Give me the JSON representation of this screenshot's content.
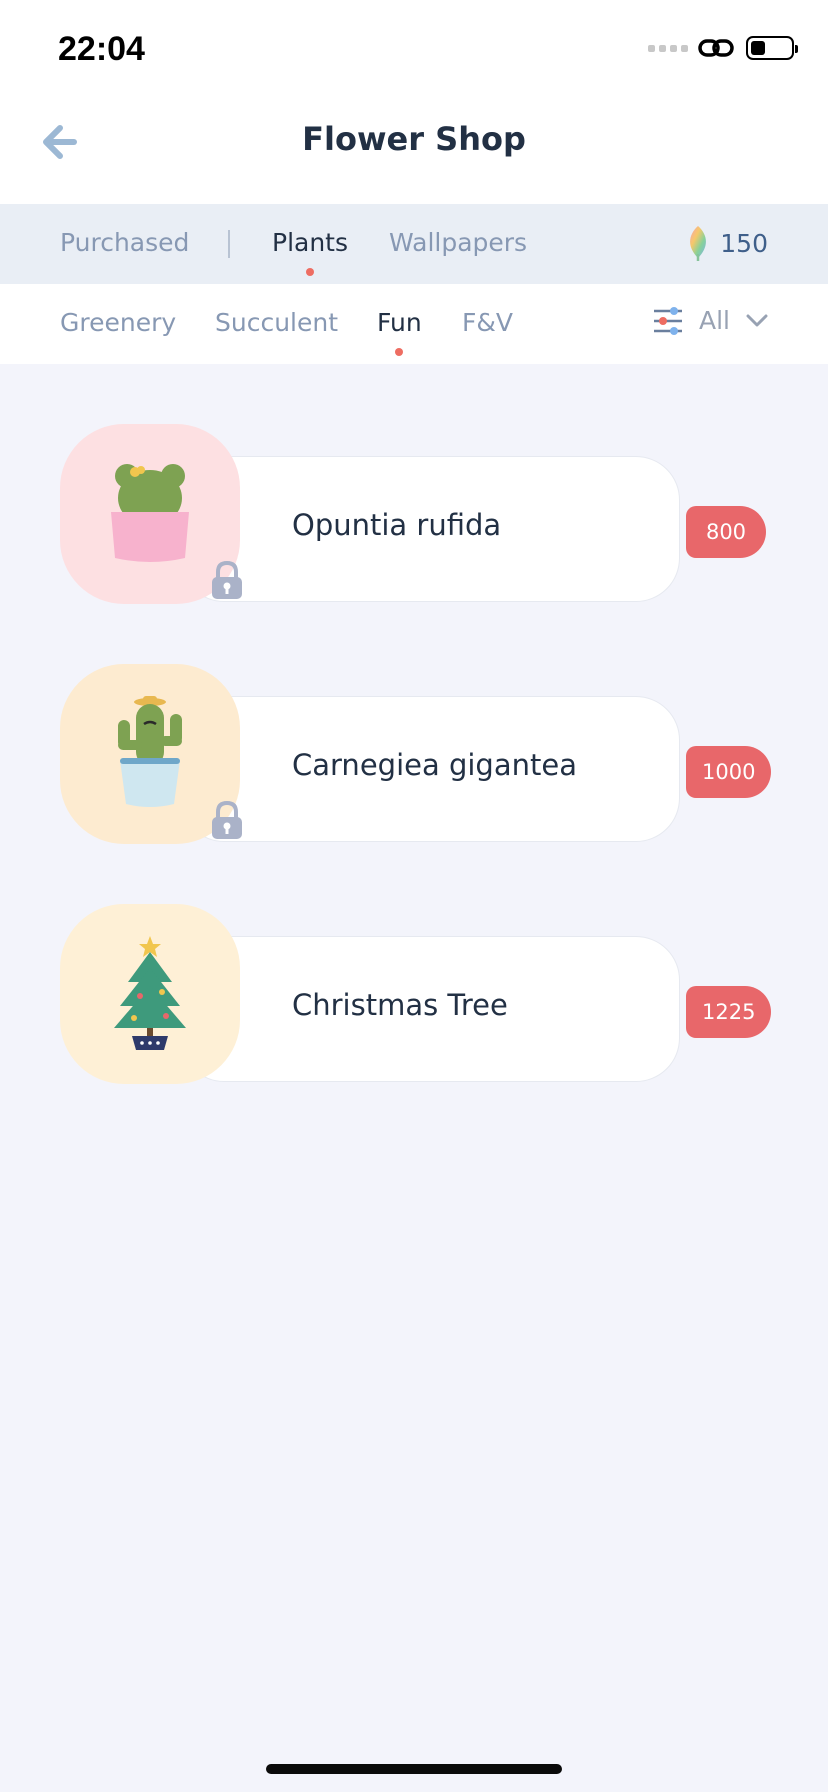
{
  "status_bar": {
    "time": "22:04"
  },
  "header": {
    "title": "Flower Shop"
  },
  "main_tabs": [
    {
      "label": "Purchased",
      "active": false
    },
    {
      "label": "Plants",
      "active": true
    },
    {
      "label": "Wallpapers",
      "active": false
    }
  ],
  "points": {
    "value": "150"
  },
  "sub_tabs": [
    {
      "label": "Greenery",
      "active": false
    },
    {
      "label": "Succulent",
      "active": false
    },
    {
      "label": "Fun",
      "active": true
    },
    {
      "label": "F&V",
      "active": false
    }
  ],
  "filter": {
    "label": "All"
  },
  "items": [
    {
      "name": "Opuntia rufida",
      "price": "800",
      "locked": true,
      "thumb_color": "#fde0e2",
      "icon": "opuntia-cactus-icon"
    },
    {
      "name": "Carnegiea gigantea",
      "price": "1000",
      "locked": true,
      "thumb_color": "#fdebd0",
      "icon": "saguaro-cactus-icon"
    },
    {
      "name": "Christmas Tree",
      "price": "1225",
      "locked": false,
      "thumb_color": "#fef0d6",
      "icon": "christmas-tree-icon"
    }
  ],
  "colors": {
    "accent": "#ee6d62",
    "price_badge": "#e8676a",
    "tab_bar_bg": "#e9eef5",
    "page_bg": "#f3f4fb",
    "active_text": "#223044",
    "inactive_text": "#8798b3"
  }
}
